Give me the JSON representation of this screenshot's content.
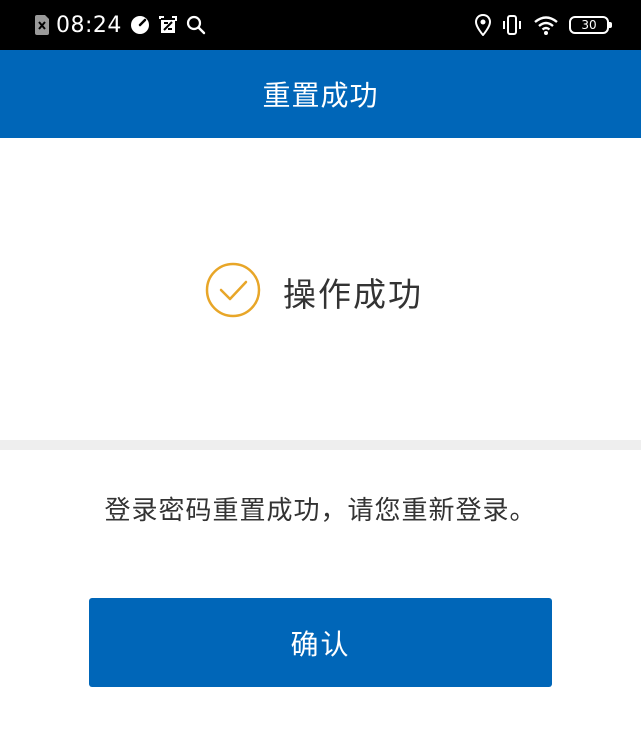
{
  "status_bar": {
    "time": "08:24",
    "battery": "30",
    "icons": [
      "sim-card-icon",
      "timer-icon",
      "screenshot-icon",
      "search-icon",
      "location-icon",
      "vibrate-icon",
      "wifi-icon",
      "battery-icon"
    ]
  },
  "header": {
    "title": "重置成功"
  },
  "result": {
    "status_icon": "check-circle-icon",
    "status_text": "操作成功",
    "accent_color": "#e8a628"
  },
  "message": "登录密码重置成功，请您重新登录。",
  "actions": {
    "confirm_label": "确认"
  },
  "colors": {
    "primary": "#0066b8",
    "status_bar": "#000000",
    "divider": "#eeeeee",
    "text": "#333333"
  }
}
